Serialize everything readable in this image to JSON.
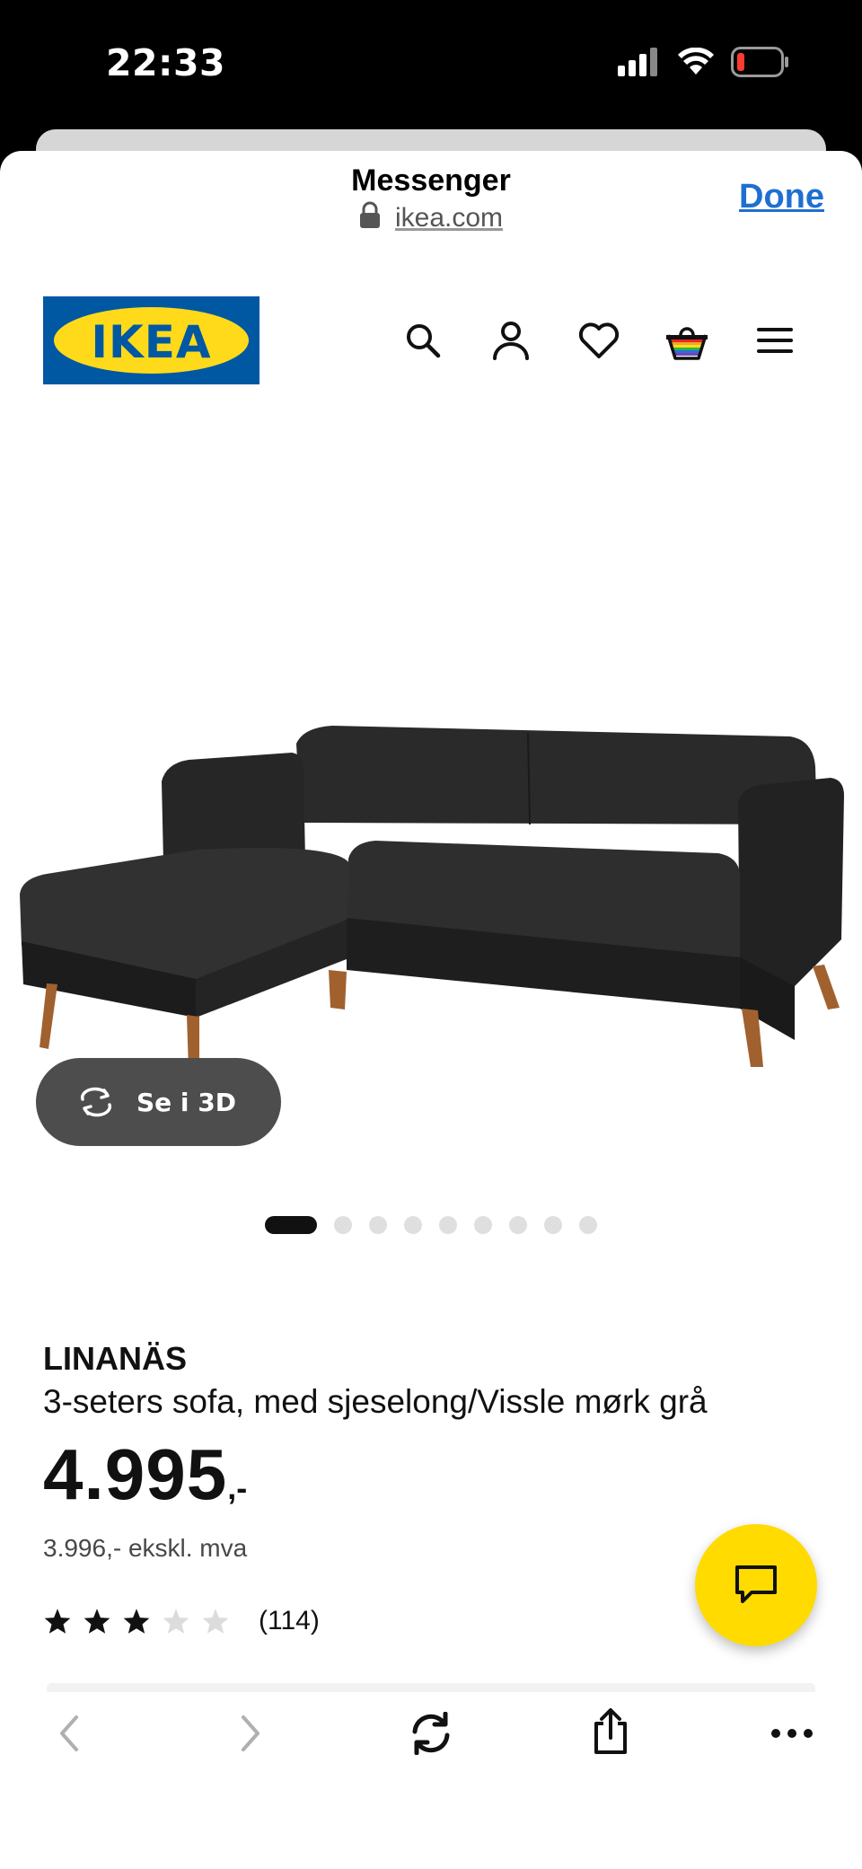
{
  "status_bar": {
    "time": "22:33"
  },
  "browser": {
    "title": "Messenger",
    "url": "ikea.com",
    "done_label": "Done"
  },
  "brand": {
    "logo_text": "IKEA",
    "blue": "#0058a3",
    "yellow": "#ffda1a"
  },
  "nav_icons": [
    "search-icon",
    "profile-icon",
    "heart-icon",
    "cart-icon",
    "menu-icon"
  ],
  "product": {
    "view_3d_label": "Se i 3D",
    "name": "LINANÄS",
    "description": "3-seters sofa, med sjeselong/Vissle mørk grå",
    "price": "4.995",
    "price_suffix": ",-",
    "price_excl": "3.996,- ekskl. mva",
    "rating": {
      "value": 3,
      "max": 5,
      "count": "(114)"
    },
    "gallery": {
      "total": 9,
      "active": 1
    }
  },
  "toolbar": {
    "icons": [
      "back-icon",
      "forward-icon",
      "reload-icon",
      "share-icon",
      "more-icon"
    ]
  },
  "colors": {
    "accent_link": "#1f6fd1",
    "chat_button": "#ffdb00",
    "button_3d": "#4d4d4d"
  }
}
